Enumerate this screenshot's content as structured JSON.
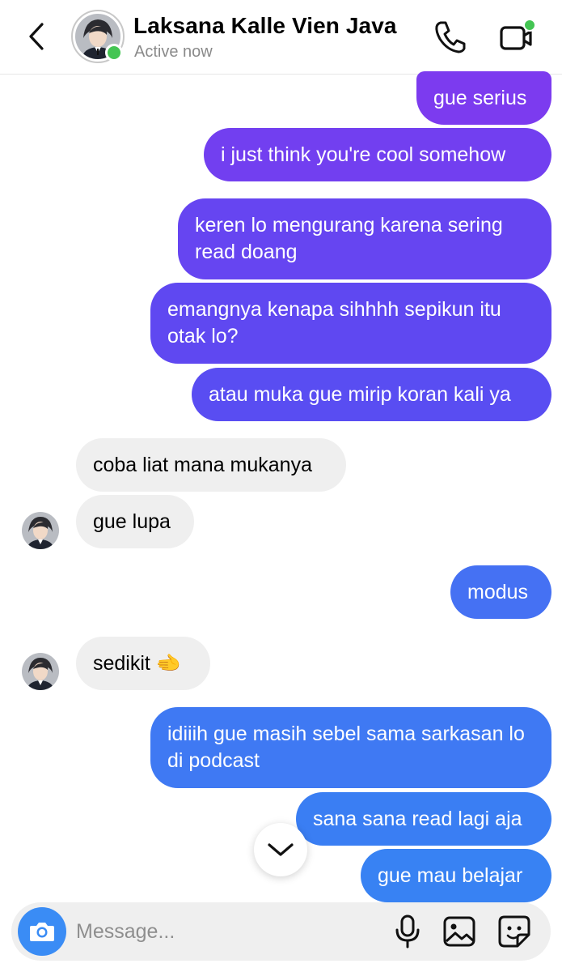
{
  "header": {
    "contact_name": "Laksana Kalle Vien Java",
    "status": "Active now"
  },
  "messages": [
    {
      "direction": "sent",
      "text": "gue serius"
    },
    {
      "direction": "sent",
      "text": "i just think you're cool somehow"
    },
    {
      "direction": "sent",
      "text": "keren lo mengurang karena sering read doang"
    },
    {
      "direction": "sent",
      "text": "emangnya kenapa sihhhh sepikun itu otak lo?"
    },
    {
      "direction": "sent",
      "text": "atau muka gue mirip koran kali ya"
    },
    {
      "direction": "received",
      "text": "coba liat mana mukanya"
    },
    {
      "direction": "received",
      "text": "gue lupa"
    },
    {
      "direction": "sent",
      "text": "modus"
    },
    {
      "direction": "received",
      "text": "sedikit 🫲"
    },
    {
      "direction": "sent",
      "text": "idiiih gue masih sebel sama sarkasan lo di podcast"
    },
    {
      "direction": "sent",
      "text": "sana sana read lagi aja"
    },
    {
      "direction": "sent",
      "text": "gue mau belajar"
    }
  ],
  "composer": {
    "placeholder": "Message..."
  },
  "colors": {
    "gradient_top": "#7a3cf0",
    "gradient_bottom": "#3a82f2",
    "received_bubble": "#efefef",
    "online_dot": "#44c553",
    "camera_button": "#3a8cf5"
  },
  "icons": [
    "back-arrow-icon",
    "phone-icon",
    "video-camera-icon",
    "chevron-down-icon",
    "camera-icon",
    "microphone-icon",
    "gallery-icon",
    "sticker-icon"
  ]
}
